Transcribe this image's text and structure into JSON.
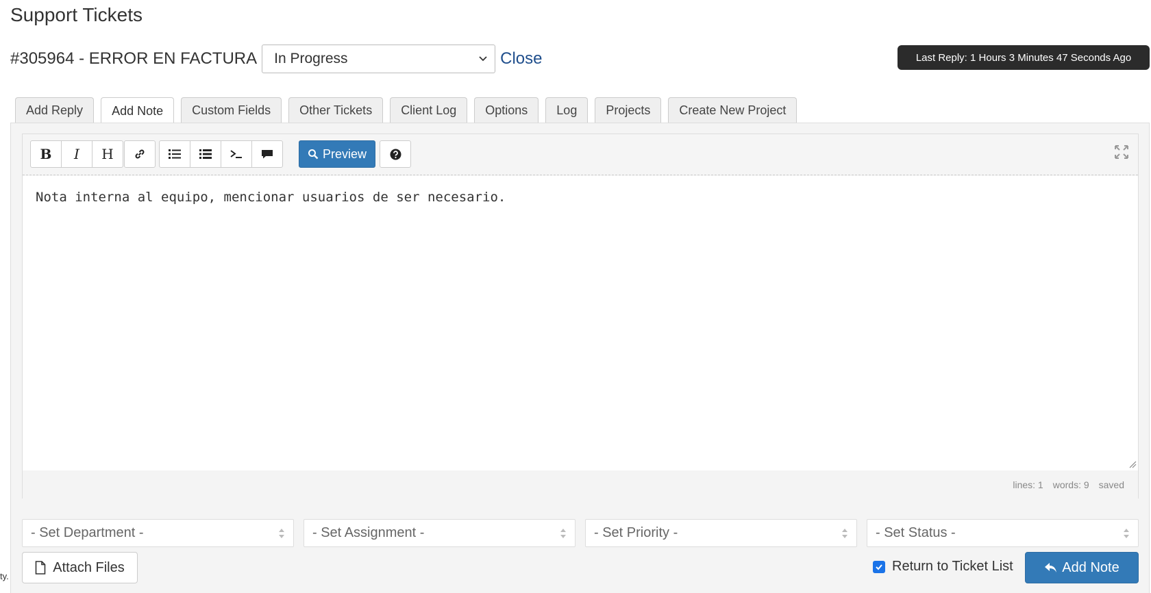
{
  "page": {
    "title": "Support Tickets"
  },
  "ticket": {
    "number_subject": "#305964 - ERROR EN FACTURA",
    "status_value": "In Progress",
    "close_label": "Close",
    "last_reply": "Last Reply: 1 Hours 3 Minutes 47 Seconds Ago"
  },
  "tabs": [
    {
      "label": "Add Reply",
      "active": false
    },
    {
      "label": "Add Note",
      "active": true
    },
    {
      "label": "Custom Fields",
      "active": false
    },
    {
      "label": "Other Tickets",
      "active": false
    },
    {
      "label": "Client Log",
      "active": false
    },
    {
      "label": "Options",
      "active": false
    },
    {
      "label": "Log",
      "active": false
    },
    {
      "label": "Projects",
      "active": false
    },
    {
      "label": "Create New Project",
      "active": false
    }
  ],
  "editor": {
    "toolbar": {
      "bold": "B",
      "italic": "I",
      "heading": "H",
      "preview_label": "Preview"
    },
    "content": "Nota interna al equipo, mencionar usuarios de ser necesario.",
    "status": {
      "lines": "lines: 1",
      "words": "words: 9",
      "saved": "saved"
    }
  },
  "selects": {
    "department": "- Set Department -",
    "assignment": "- Set Assignment -",
    "priority": "- Set Priority -",
    "status": "- Set Status -"
  },
  "actions": {
    "attach_files": "Attach Files",
    "return_to_list": "Return to Ticket List",
    "return_checked": true,
    "add_note": "Add Note"
  },
  "edge_text": "ty.",
  "colors": {
    "primary": "#337ab7",
    "tooltip_bg": "#2b2b2b",
    "link": "#1f4e8c",
    "checkbox": "#1a73e8"
  }
}
